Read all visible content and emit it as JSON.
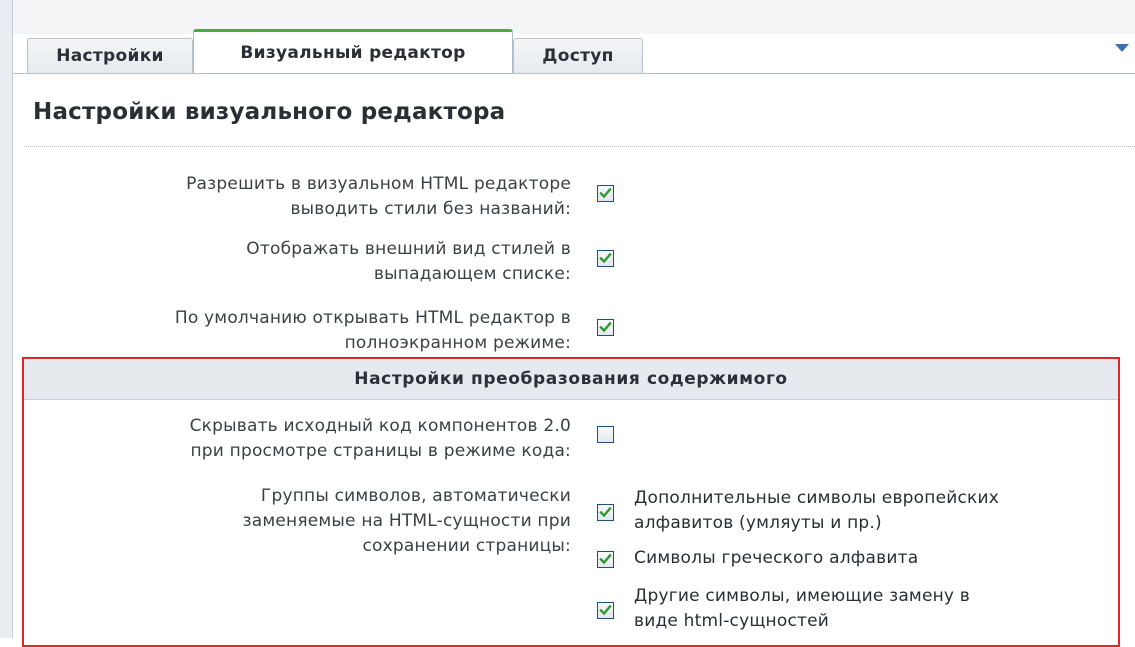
{
  "tabs": [
    {
      "label": "Настройки",
      "active": false
    },
    {
      "label": "Визуальный редактор",
      "active": true
    },
    {
      "label": "Доступ",
      "active": false
    }
  ],
  "page": {
    "title": "Настройки визуального редактора"
  },
  "settings": [
    {
      "label_line1": "Разрешить в визуальном HTML редакторе",
      "label_line2": "выводить стили без названий:",
      "checked": true
    },
    {
      "label_line1": "Отображать внешний вид стилей в",
      "label_line2": "выпадающем списке:",
      "checked": true
    },
    {
      "label_line1": "По умолчанию открывать HTML редактор в",
      "label_line2": "полноэкранном режиме:",
      "checked": true
    }
  ],
  "conversion_section": {
    "header": "Настройки преобразования содержимого",
    "hide_source": {
      "label_line1": "Скрывать исходный код компонентов 2.0",
      "label_line2": "при просмотре страницы в режиме кода:",
      "checked": false
    },
    "entity_groups": {
      "label_line1": "Группы символов, автоматически",
      "label_line2": "заменяемые на HTML-сущности при",
      "label_line3": "сохранении страницы:",
      "options": [
        {
          "line1": "Дополнительные символы европейских",
          "line2": "алфавитов (умляуты и пр.)",
          "checked": true
        },
        {
          "line1": "Символы греческого алфавита",
          "line2": "",
          "checked": true
        },
        {
          "line1": "Другие символы, имеющие замену в",
          "line2": "виде html-сущностей",
          "checked": true
        }
      ]
    }
  },
  "colors": {
    "active_tab_accent": "#3fae4a",
    "highlight_border": "#e0262b",
    "checkbox_check": "#2f9a32"
  }
}
